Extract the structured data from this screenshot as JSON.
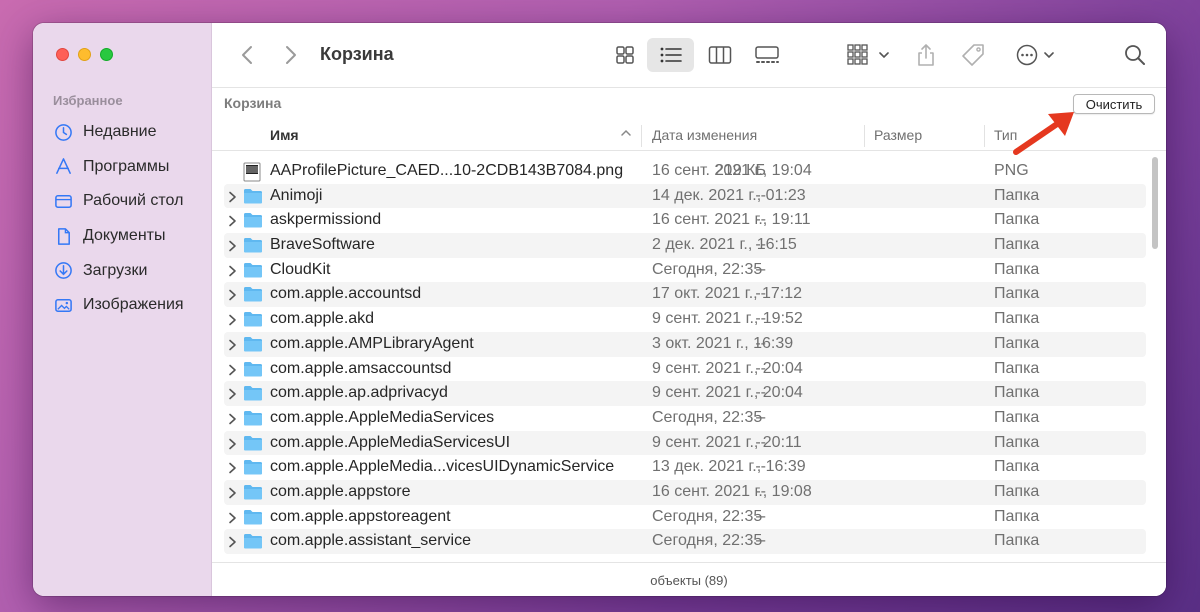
{
  "window": {
    "title": "Корзина"
  },
  "sidebar": {
    "section": "Избранное",
    "items": [
      {
        "label": "Недавние",
        "icon": "clock-icon"
      },
      {
        "label": "Программы",
        "icon": "applications-icon"
      },
      {
        "label": "Рабочий стол",
        "icon": "desktop-icon"
      },
      {
        "label": "Документы",
        "icon": "document-icon"
      },
      {
        "label": "Загрузки",
        "icon": "download-icon"
      },
      {
        "label": "Изображения",
        "icon": "photos-icon"
      }
    ]
  },
  "pathbar": {
    "title": "Корзина",
    "empty_label": "Очистить"
  },
  "columns": {
    "name": "Имя",
    "date": "Дата изменения",
    "size": "Размер",
    "kind": "Тип"
  },
  "files": [
    {
      "name": "AAProfilePicture_CAED...10-2CDB143B7084.png",
      "date": "16 сент. 2021 г., 19:04",
      "size": "219 КБ",
      "kind": "PNG",
      "type": "image"
    },
    {
      "name": "Animoji",
      "date": "14 дек. 2021 г., 01:23",
      "size": "--",
      "kind": "Папка",
      "type": "folder"
    },
    {
      "name": "askpermissiond",
      "date": "16 сент. 2021 г., 19:11",
      "size": "--",
      "kind": "Папка",
      "type": "folder"
    },
    {
      "name": "BraveSoftware",
      "date": "2 дек. 2021 г., 16:15",
      "size": "--",
      "kind": "Папка",
      "type": "folder"
    },
    {
      "name": "CloudKit",
      "date": "Сегодня, 22:35",
      "size": "--",
      "kind": "Папка",
      "type": "folder"
    },
    {
      "name": "com.apple.accountsd",
      "date": "17 окт. 2021 г., 17:12",
      "size": "--",
      "kind": "Папка",
      "type": "folder"
    },
    {
      "name": "com.apple.akd",
      "date": "9 сент. 2021 г., 19:52",
      "size": "--",
      "kind": "Папка",
      "type": "folder"
    },
    {
      "name": "com.apple.AMPLibraryAgent",
      "date": "3 окт. 2021 г., 16:39",
      "size": "--",
      "kind": "Папка",
      "type": "folder"
    },
    {
      "name": "com.apple.amsaccountsd",
      "date": "9 сент. 2021 г., 20:04",
      "size": "--",
      "kind": "Папка",
      "type": "folder"
    },
    {
      "name": "com.apple.ap.adprivacyd",
      "date": "9 сент. 2021 г., 20:04",
      "size": "--",
      "kind": "Папка",
      "type": "folder"
    },
    {
      "name": "com.apple.AppleMediaServices",
      "date": "Сегодня, 22:35",
      "size": "--",
      "kind": "Папка",
      "type": "folder"
    },
    {
      "name": "com.apple.AppleMediaServicesUI",
      "date": "9 сент. 2021 г., 20:11",
      "size": "--",
      "kind": "Папка",
      "type": "folder"
    },
    {
      "name": "com.apple.AppleMedia...vicesUIDynamicService",
      "date": "13 дек. 2021 г., 16:39",
      "size": "--",
      "kind": "Папка",
      "type": "folder"
    },
    {
      "name": "com.apple.appstore",
      "date": "16 сент. 2021 г., 19:08",
      "size": "--",
      "kind": "Папка",
      "type": "folder"
    },
    {
      "name": "com.apple.appstoreagent",
      "date": "Сегодня, 22:35",
      "size": "--",
      "kind": "Папка",
      "type": "folder"
    },
    {
      "name": "com.apple.assistant_service",
      "date": "Сегодня, 22:35",
      "size": "--",
      "kind": "Папка",
      "type": "folder"
    }
  ],
  "status": {
    "text": "объекты (89)"
  },
  "colors": {
    "folder": "#5fb8f0",
    "sidebar_icon": "#3478f6",
    "arrow": "#e5381f"
  }
}
